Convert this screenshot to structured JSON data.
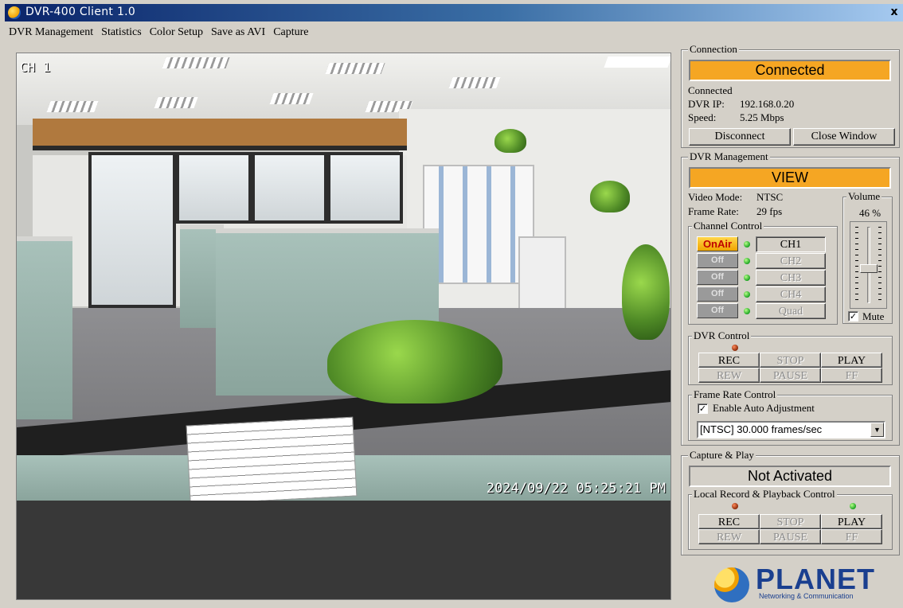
{
  "window": {
    "title": "DVR-400 Client 1.0",
    "close_glyph": "x"
  },
  "menu": [
    "DVR Management",
    "Statistics",
    "Color Setup",
    "Save as AVI",
    "Capture"
  ],
  "video": {
    "channel_label": "CH 1",
    "timestamp": "2024/09/22 05:25:21 PM"
  },
  "connection": {
    "legend": "Connection",
    "status": "Connected",
    "status_color": "#f5a623",
    "text": "Connected",
    "ip_label": "DVR IP:",
    "ip": "192.168.0.20",
    "speed_label": "Speed:",
    "speed": "5.25 Mbps",
    "disconnect": "Disconnect",
    "close_window": "Close Window"
  },
  "dvr_management": {
    "legend": "DVR Management",
    "mode": "VIEW",
    "video_mode_label": "Video Mode:",
    "video_mode": "NTSC",
    "frame_rate_label": "Frame Rate:",
    "frame_rate": "29 fps",
    "volume": {
      "legend": "Volume",
      "value": "46 %",
      "level": 0.46,
      "mute_label": "Mute",
      "mute_checked": true
    },
    "channel_control": {
      "legend": "Channel Control",
      "channels": [
        {
          "state": "OnAir",
          "name": "CH1",
          "enabled": true
        },
        {
          "state": "Off",
          "name": "CH2",
          "enabled": false
        },
        {
          "state": "Off",
          "name": "CH3",
          "enabled": false
        },
        {
          "state": "Off",
          "name": "CH4",
          "enabled": false
        },
        {
          "state": "Off",
          "name": "Quad",
          "enabled": false
        }
      ]
    },
    "dvr_control": {
      "legend": "DVR Control",
      "rec": "REC",
      "stop": "STOP",
      "play": "PLAY",
      "rew": "REW",
      "pause": "PAUSE",
      "ff": "FF"
    },
    "frame_rate_control": {
      "legend": "Frame Rate Control",
      "auto_label": "Enable Auto Adjustment",
      "auto_checked": true,
      "selected": "[NTSC] 30.000 frames/sec"
    }
  },
  "capture_play": {
    "legend": "Capture & Play",
    "status": "Not Activated",
    "local": {
      "legend": "Local Record & Playback Control",
      "rec": "REC",
      "stop": "STOP",
      "play": "PLAY",
      "rew": "REW",
      "pause": "PAUSE",
      "ff": "FF"
    }
  },
  "logo": {
    "word": "PLANET",
    "tagline": "Networking & Communication",
    "icon": "planet-globe-icon"
  }
}
